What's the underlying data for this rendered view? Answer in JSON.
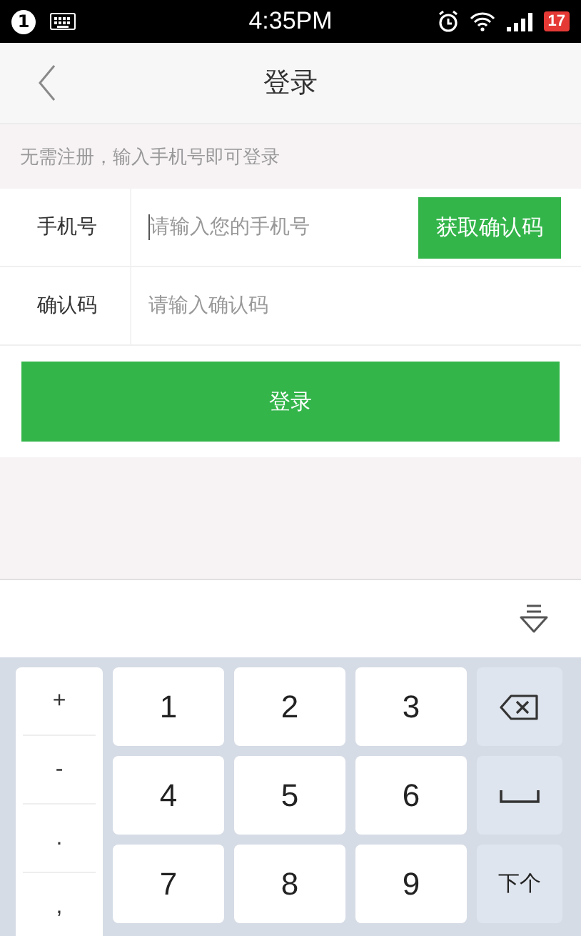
{
  "status_bar": {
    "notification_count": "1",
    "time": "4:35PM",
    "battery": "17"
  },
  "nav": {
    "title": "登录"
  },
  "hint": "无需注册，输入手机号即可登录",
  "form": {
    "fields": [
      {
        "label": "手机号",
        "placeholder": "请输入您的手机号",
        "focused": true
      },
      {
        "label": "确认码",
        "placeholder": "请输入确认码",
        "focused": false
      }
    ],
    "get_code_button": "获取确认码"
  },
  "login_button": "登录",
  "keyboard": {
    "symbols": [
      "+",
      "-",
      ".",
      ","
    ],
    "keys": [
      {
        "kind": "digit",
        "label": "1"
      },
      {
        "kind": "digit",
        "label": "2"
      },
      {
        "kind": "digit",
        "label": "3"
      },
      {
        "kind": "backspace"
      },
      {
        "kind": "digit",
        "label": "4"
      },
      {
        "kind": "digit",
        "label": "5"
      },
      {
        "kind": "digit",
        "label": "6"
      },
      {
        "kind": "space"
      },
      {
        "kind": "digit",
        "label": "7"
      },
      {
        "kind": "digit",
        "label": "8"
      },
      {
        "kind": "digit",
        "label": "9"
      },
      {
        "kind": "action",
        "label": "下个"
      }
    ]
  }
}
